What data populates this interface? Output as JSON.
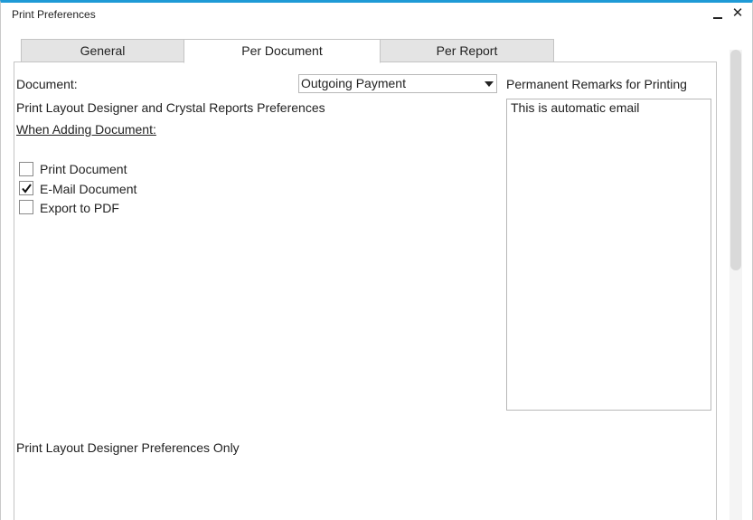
{
  "window": {
    "title": "Print Preferences",
    "minimize": "–",
    "close": "✕"
  },
  "tabs": [
    {
      "label": "General",
      "active": false
    },
    {
      "label": "Per Document",
      "active": true
    },
    {
      "label": "Per Report",
      "active": false
    }
  ],
  "form": {
    "document_label": "Document:",
    "document_value": "Outgoing Payment",
    "section_title": "Print Layout Designer and Crystal Reports Preferences",
    "when_adding_label": "When Adding Document:",
    "checkboxes": [
      {
        "label": "Print Document",
        "checked": false
      },
      {
        "label": "E-Mail Document",
        "checked": true
      },
      {
        "label": "Export to PDF",
        "checked": false
      }
    ],
    "remarks_label": "Permanent Remarks for Printing",
    "remarks_value": "This is automatic email",
    "pld_only_label": "Print Layout Designer Preferences Only"
  },
  "colors": {
    "accent": "#1f9ad6",
    "tab_inactive": "#e4e4e4",
    "border": "#c4c4c4"
  }
}
